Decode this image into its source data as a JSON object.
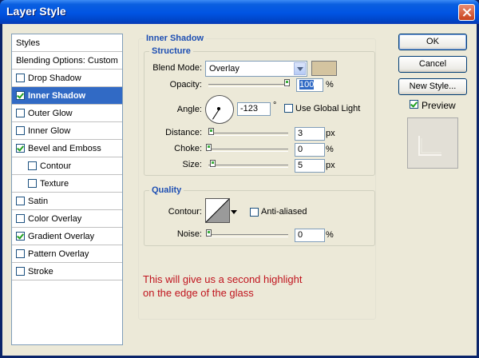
{
  "window": {
    "title": "Layer Style"
  },
  "styles_panel": {
    "header": "Styles",
    "blending_options": "Blending Options: Custom",
    "items": [
      {
        "label": "Drop Shadow",
        "checked": false,
        "sub": false,
        "selected": false
      },
      {
        "label": "Inner Shadow",
        "checked": true,
        "sub": false,
        "selected": true
      },
      {
        "label": "Outer Glow",
        "checked": false,
        "sub": false,
        "selected": false
      },
      {
        "label": "Inner Glow",
        "checked": false,
        "sub": false,
        "selected": false
      },
      {
        "label": "Bevel and Emboss",
        "checked": true,
        "sub": false,
        "selected": false
      },
      {
        "label": "Contour",
        "checked": false,
        "sub": true,
        "selected": false
      },
      {
        "label": "Texture",
        "checked": false,
        "sub": true,
        "selected": false
      },
      {
        "label": "Satin",
        "checked": false,
        "sub": false,
        "selected": false
      },
      {
        "label": "Color Overlay",
        "checked": false,
        "sub": false,
        "selected": false
      },
      {
        "label": "Gradient Overlay",
        "checked": true,
        "sub": false,
        "selected": false
      },
      {
        "label": "Pattern Overlay",
        "checked": false,
        "sub": false,
        "selected": false
      },
      {
        "label": "Stroke",
        "checked": false,
        "sub": false,
        "selected": false
      }
    ]
  },
  "inner_shadow": {
    "section_title": "Inner Shadow",
    "structure": {
      "title": "Structure",
      "blend_mode_label": "Blend Mode:",
      "blend_mode_value": "Overlay",
      "color_swatch": "#d4c4a0",
      "opacity_label": "Opacity:",
      "opacity_value": "100",
      "opacity_unit": "%",
      "angle_label": "Angle:",
      "angle_value": "-123",
      "angle_unit": "°",
      "use_global_light_label": "Use Global Light",
      "use_global_light_checked": false,
      "distance_label": "Distance:",
      "distance_value": "3",
      "distance_unit": "px",
      "choke_label": "Choke:",
      "choke_value": "0",
      "choke_unit": "%",
      "size_label": "Size:",
      "size_value": "5",
      "size_unit": "px"
    },
    "quality": {
      "title": "Quality",
      "contour_label": "Contour:",
      "anti_aliased_label": "Anti-aliased",
      "anti_aliased_checked": false,
      "noise_label": "Noise:",
      "noise_value": "0",
      "noise_unit": "%"
    }
  },
  "buttons": {
    "ok": "OK",
    "cancel": "Cancel",
    "new_style": "New Style...",
    "preview_label": "Preview",
    "preview_checked": true
  },
  "annotation": {
    "line1": "This will give us a second highlight",
    "line2": "on the edge of the glass"
  }
}
